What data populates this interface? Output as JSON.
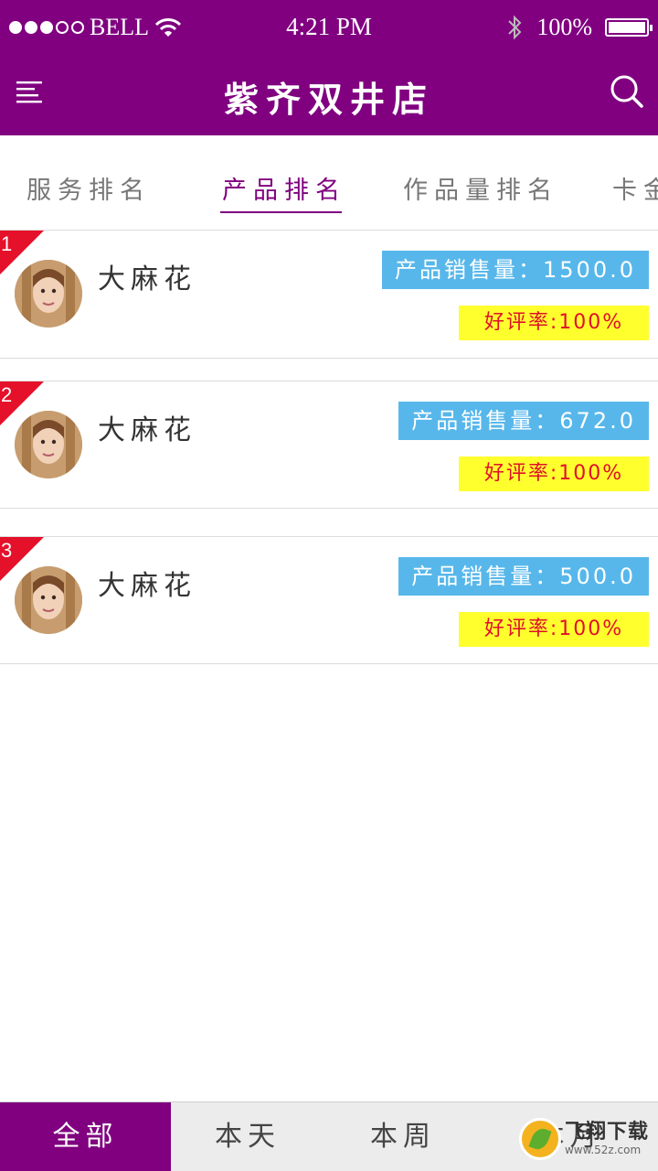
{
  "status_bar": {
    "carrier": "BELL",
    "time": "4:21 PM",
    "battery": "100%"
  },
  "navbar": {
    "title": "紫齐双井店"
  },
  "tabs": [
    {
      "label": "服务排名",
      "active": false
    },
    {
      "label": "产品排名",
      "active": true
    },
    {
      "label": "作品量排名",
      "active": false
    },
    {
      "label": "卡金",
      "active": false
    }
  ],
  "rankings": [
    {
      "rank": "1",
      "name": "大麻花",
      "sales": "产品销售量：1500.0",
      "rating": "好评率:100%"
    },
    {
      "rank": "2",
      "name": "大麻花",
      "sales": "产品销售量：672.0",
      "rating": "好评率:100%"
    },
    {
      "rank": "3",
      "name": "大麻花",
      "sales": "产品销售量：500.0",
      "rating": "好评率:100%"
    }
  ],
  "bottom_tabs": [
    {
      "label": "全部",
      "active": true
    },
    {
      "label": "本天",
      "active": false
    },
    {
      "label": "本周",
      "active": false
    },
    {
      "label": "本月",
      "active": false
    }
  ],
  "watermark": {
    "text": "飞翔下载",
    "url": "www.52z.com"
  },
  "colors": {
    "brand": "#800080",
    "sales_badge": "#57b7ea",
    "rating_badge": "#ffff2e",
    "rating_text": "#e0102a",
    "rank_flag": "#e5102a"
  }
}
